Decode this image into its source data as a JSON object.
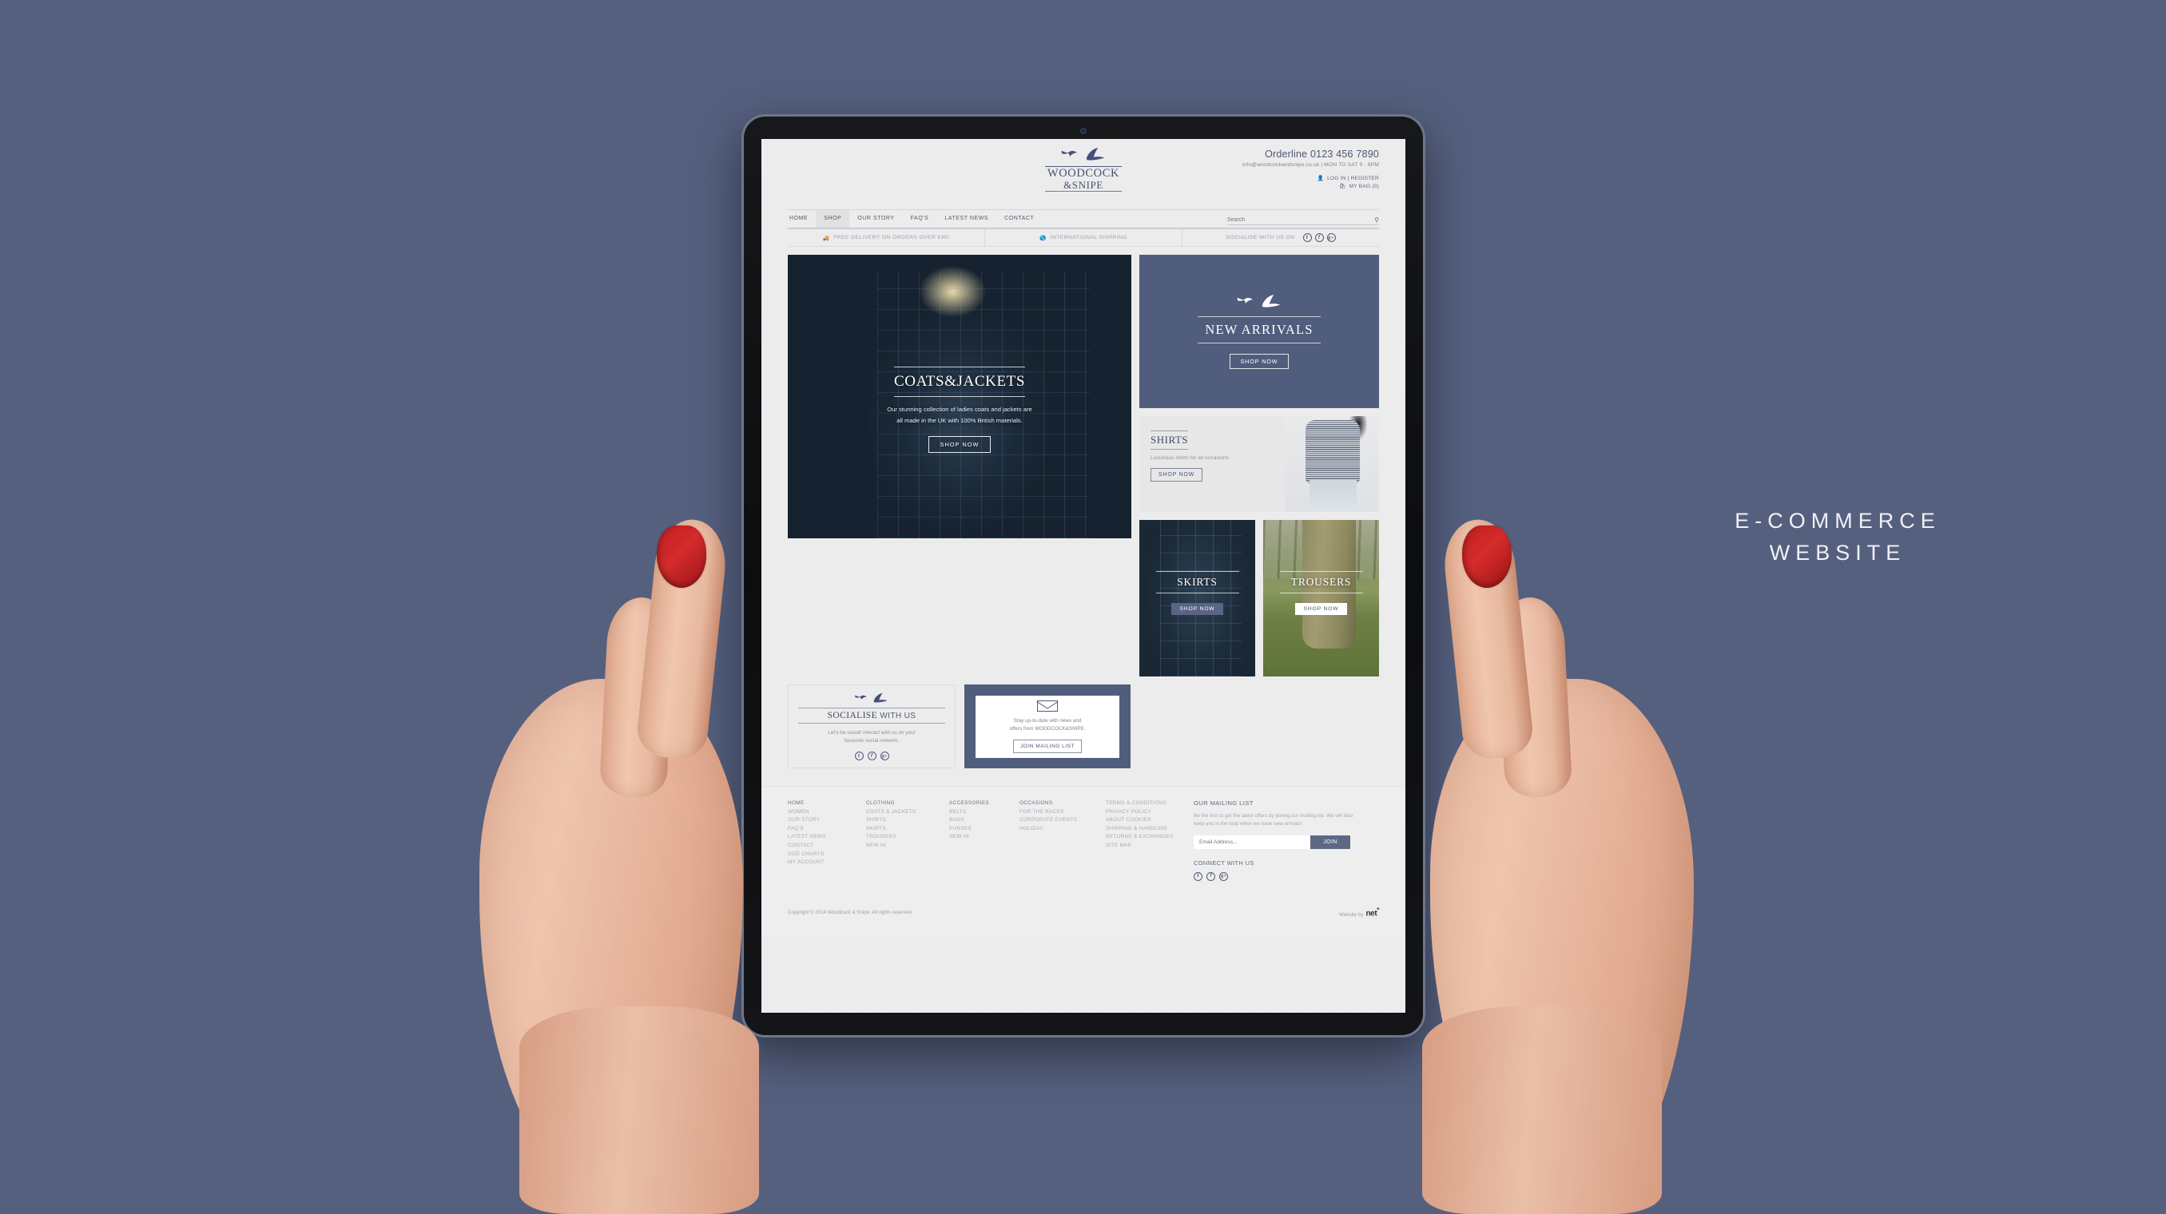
{
  "caption": {
    "line1": "E-COMMERCE",
    "line2": "WEBSITE"
  },
  "site": {
    "header": {
      "logo": {
        "word1": "WOODCOCK",
        "word2": "&SNIPE",
        "birds_icon": "two-birds-icon"
      },
      "orderline": "Orderline 0123 456 7890",
      "email": "info@woodcockandsnipe.co.uk",
      "separator": "|",
      "hours": "MON TO SAT 9 - 6PM",
      "login": "LOG IN",
      "register": "REGISTER",
      "bag": "MY BAG (0)"
    },
    "nav": {
      "items": [
        {
          "label": "HOME",
          "active": false
        },
        {
          "label": "SHOP",
          "active": true
        },
        {
          "label": "OUR STORY",
          "active": false
        },
        {
          "label": "FAQ'S",
          "active": false
        },
        {
          "label": "LATEST NEWS",
          "active": false
        },
        {
          "label": "CONTACT",
          "active": false
        }
      ],
      "search_placeholder": "Search"
    },
    "promo": {
      "delivery": "FREE DELIVERY ON ORDERS OVER £95!",
      "shipping": "INTERNATIONAL SHIPPING",
      "socialise": "SOCIALISE WITH US ON",
      "socials": [
        "f",
        "t",
        "g+"
      ]
    },
    "hero": {
      "title": "COATS&JACKETS",
      "sub_line1": "Our stunning collection of ladies coats and jackets are",
      "sub_line2": "all made in the UK with 100% British materials.",
      "cta": "SHOP NOW"
    },
    "arrivals": {
      "title": "NEW ARRIVALS",
      "cta": "SHOP NOW"
    },
    "shirts": {
      "title": "SHIRTS",
      "sub": "Luxurious shirts for all occasions",
      "cta": "SHOP NOW"
    },
    "tiles": [
      {
        "title": "SKIRTS",
        "cta": "SHOP NOW"
      },
      {
        "title": "TROUSERS",
        "cta": "SHOP NOW"
      }
    ],
    "social_box": {
      "title_strong": "SOCIALISE",
      "title_light": "WITH US",
      "sub_line1": "Let's be social! interact with us on your",
      "sub_line2": "favourite social network."
    },
    "mail_box": {
      "sub_line1": "Stay up-to-date with news and",
      "sub_line2": "offers from WOODCOCK&SNIPE.",
      "cta": "JOIN MAILING LIST"
    },
    "footer": {
      "columns": [
        {
          "heading": "HOME",
          "links": [
            "WOMEN",
            "OUR STORY",
            "FAQ'S",
            "LATEST NEWS",
            "CONTACT",
            "SIZE CHARTS",
            "MY ACCOUNT"
          ]
        },
        {
          "heading": "CLOTHING",
          "links": [
            "COATS & JACKETS",
            "SHIRTS",
            "SKIRTS",
            "TROUSERS",
            "NEW IN"
          ]
        },
        {
          "heading": "ACCESSORIES",
          "links": [
            "BELTS",
            "BAGS",
            "PURSES",
            "NEW IN"
          ]
        },
        {
          "heading": "OCCASIONS",
          "links": [
            "FOR THE RACES",
            "CORPORATE EVENTS",
            "HOLIDAY"
          ]
        },
        {
          "heading": "",
          "links": [
            "TERMS & CONDITIONS",
            "PRIVACY POLICY",
            "ABOUT COOKIES",
            "SHIPPING & HANDLING",
            "RETURNS & EXCHANGES",
            "SITE MAP"
          ]
        }
      ],
      "mailing_heading": "OUR MAILING LIST",
      "mailing_body": "Be the first to get the latest offers by joining our mailing list. We will also keep you in the loop when we have new arrivals!",
      "email_placeholder": "Email Address...",
      "join_label": "JOIN",
      "connect_heading": "CONNECT WITH US",
      "socials": [
        "f",
        "t",
        "g+"
      ]
    },
    "copyright": {
      "text": "Copyright © 2014 Woodcock & Snipe. All rights reserved.",
      "website_by": "Website by",
      "agency": "net",
      "agency_mark": "*"
    }
  }
}
